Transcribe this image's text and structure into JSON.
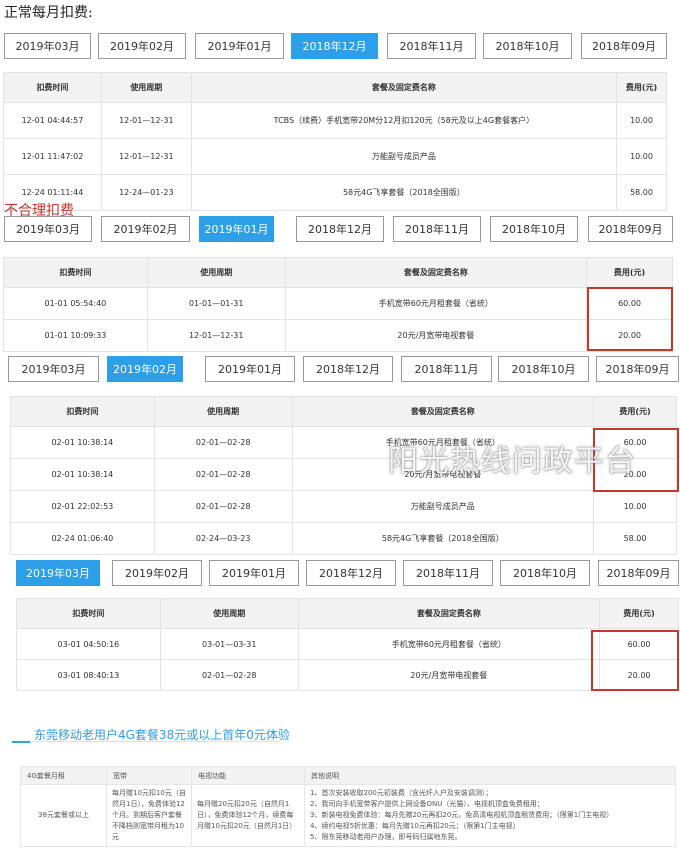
{
  "section1": {
    "title": "正常每月扣费:",
    "tabs": [
      "2019年03月",
      "2019年02月",
      "2019年01月",
      "2018年12月",
      "2018年11月",
      "2018年10月",
      "2018年09月"
    ],
    "active": 3,
    "headers": [
      "扣费时间",
      "使用周期",
      "套餐及固定费名称",
      "费用(元)"
    ],
    "rows": [
      [
        "12-01 04:44:57",
        "12-01—12-31",
        "TCBS（续费）手机宽带20M分12月扣120元（58元及以上4G套餐客户）",
        "10.00"
      ],
      [
        "12-01 11:47:02",
        "12-01—12-31",
        "万能副号成员产品",
        "10.00"
      ],
      [
        "12-24 01:11:44",
        "12-24—01-23",
        "58元4G飞享套餐（2018全国版）",
        "58.00"
      ]
    ]
  },
  "section2": {
    "title": "不合理扣费",
    "tabs": [
      "2019年03月",
      "2019年02月",
      "2019年01月",
      "2018年12月",
      "2018年11月",
      "2018年10月",
      "2018年09月"
    ],
    "active": 2,
    "headers": [
      "扣费时间",
      "使用周期",
      "套餐及固定费名称",
      "费用(元)"
    ],
    "rows": [
      [
        "01-01 05:54:40",
        "01-01—01-31",
        "手机宽带60元月租套餐（省统）",
        "60.00"
      ],
      [
        "01-01 10:09:33",
        "12-01—12-31",
        "20元/月宽带电视套餐",
        "20.00"
      ]
    ]
  },
  "section3": {
    "tabs": [
      "2019年03月",
      "2019年02月",
      "2019年01月",
      "2018年12月",
      "2018年11月",
      "2018年10月",
      "2018年09月"
    ],
    "active": 1,
    "headers": [
      "扣费时间",
      "使用周期",
      "套餐及固定费名称",
      "费用(元)"
    ],
    "rows": [
      [
        "02-01 10:38:14",
        "02-01—02-28",
        "手机宽带60元月租套餐（省统）",
        "60.00"
      ],
      [
        "02-01 10:38:14",
        "02-01—02-28",
        "20元/月宽带电视套餐",
        "20.00"
      ],
      [
        "02-01 22:02:53",
        "02-01—02-28",
        "万能副号成员产品",
        "10.00"
      ],
      [
        "02-24 01:06:40",
        "02-24—03-23",
        "58元4G飞享套餐（2018全国版）",
        "58.00"
      ]
    ]
  },
  "section4": {
    "tabs": [
      "2019年03月",
      "2019年02月",
      "2019年01月",
      "2018年12月",
      "2018年11月",
      "2018年10月",
      "2018年09月"
    ],
    "active": 0,
    "headers": [
      "扣费时间",
      "使用周期",
      "套餐及固定费名称",
      "费用(元)"
    ],
    "rows": [
      [
        "03-01 04:50:16",
        "03-01—03-31",
        "手机宽带60元月租套餐（省统）",
        "60.00"
      ],
      [
        "03-01 08:40:13",
        "02-01—02-28",
        "20元/月宽带电视套餐",
        "20.00"
      ]
    ]
  },
  "watermark": "阳光热线问政平台",
  "promo": {
    "title": "东莞移动老用户4G套餐38元或以上首年0元体验",
    "headers": [
      "4G套餐月租",
      "宽带",
      "电视功能",
      "其他说明"
    ],
    "row": {
      "plan": "38元套餐或以上",
      "broadband": "每月赠10元扣10元（自然月1日），免费体验12个月。到期后客户套餐不降档则宽带月租为10元",
      "tv": "每月赠20元扣20元（自然月1日），免费体验12个月，续费每月赠10元扣20元（自然月1日）",
      "notes": [
        "1、首次安装收取200元初装费（含光纤入户及安装调测）；",
        "2、我司向手机宽带客户提供上网设备ONU（光猫）、电视机顶盒免费租用；",
        "3、新装电视免费体验：每月先赠20元再扣20元，免高清电视机顶盒租赁费用；（限第1门主电视）",
        "4、续约电视5折优惠：每月先赠10元再扣20元；（限第1门主电视）",
        "5、限东莞移动老用户办理，即号码归属地东莞。"
      ]
    }
  },
  "colors": {
    "accent": "#2d9ee8",
    "alert": "#c0392b"
  }
}
